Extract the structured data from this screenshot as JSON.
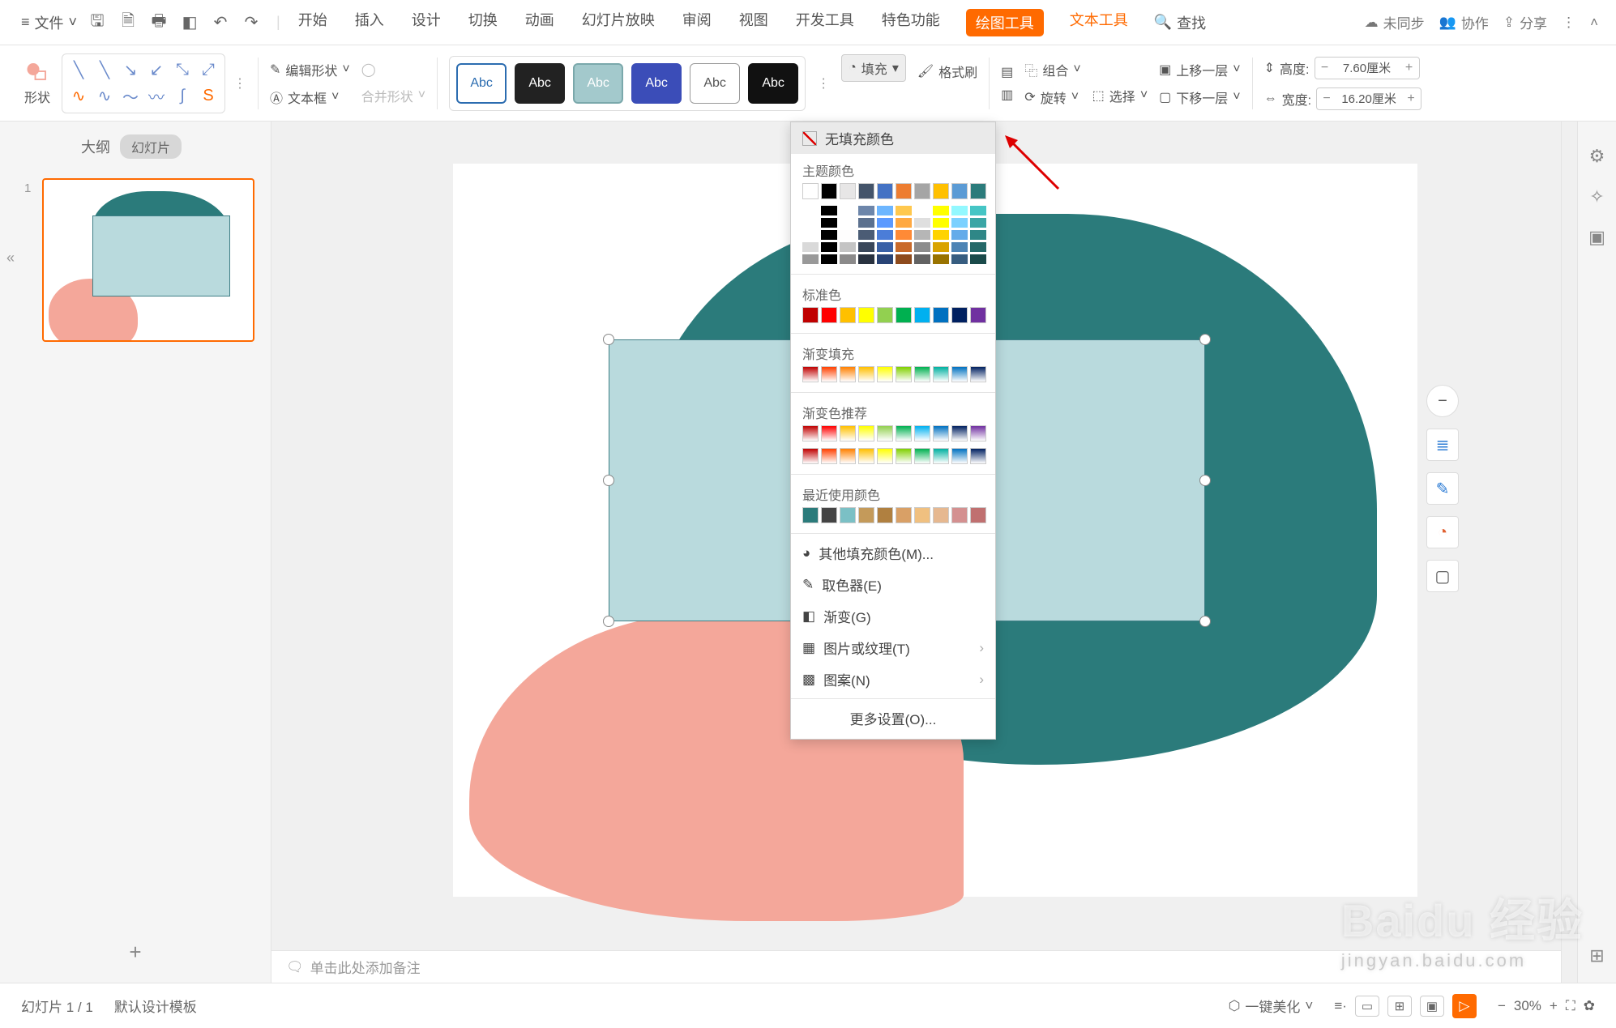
{
  "topbar": {
    "file_label": "文件",
    "tabs": [
      "开始",
      "插入",
      "设计",
      "切换",
      "动画",
      "幻灯片放映",
      "审阅",
      "视图",
      "开发工具",
      "特色功能"
    ],
    "drawing_tools": "绘图工具",
    "text_tools": "文本工具",
    "search": "查找",
    "unsynced": "未同步",
    "collab": "协作",
    "share": "分享"
  },
  "ribbon": {
    "shape_label": "形状",
    "edit_shape": "编辑形状",
    "textbox": "文本框",
    "merge_shape": "合并形状",
    "abc": "Abc",
    "fill_btn": "填充",
    "format_painter": "格式刷",
    "group": "组合",
    "rotate": "旋转",
    "select": "选择",
    "bring_forward": "上移一层",
    "send_backward": "下移一层",
    "height_label": "高度:",
    "width_label": "宽度:",
    "height_val": "7.60厘米",
    "width_val": "16.20厘米"
  },
  "side": {
    "outline": "大纲",
    "slides": "幻灯片",
    "slide_num": "1"
  },
  "fill_dropdown": {
    "no_fill": "无填充颜色",
    "theme": "主题颜色",
    "standard": "标准色",
    "gradient_fill": "渐变填充",
    "gradient_preset": "渐变色推荐",
    "recent": "最近使用颜色",
    "more_fill": "其他填充颜色(M)...",
    "eyedropper": "取色器(E)",
    "gradient": "渐变(G)",
    "picture_texture": "图片或纹理(T)",
    "pattern": "图案(N)",
    "more_settings": "更多设置(O)...",
    "theme_base": [
      "#ffffff",
      "#000000",
      "#e7e6e6",
      "#44546a",
      "#4472c4",
      "#ed7d31",
      "#a5a5a5",
      "#ffc000",
      "#5b9bd5",
      "#2b7b7b"
    ],
    "standard_colors": [
      "#c00000",
      "#ff0000",
      "#ffc000",
      "#ffff00",
      "#92d050",
      "#00b050",
      "#00b0f0",
      "#0070c0",
      "#002060",
      "#7030a0"
    ],
    "gradient_colors": [
      "#c00000",
      "#ff4000",
      "#ff8000",
      "#ffbf00",
      "#ffff00",
      "#80d000",
      "#00b050",
      "#00b0a0",
      "#0070c0",
      "#002060"
    ],
    "recent_colors": [
      "#2b7b7b",
      "#444444",
      "#7bc0c5",
      "#c49a5a",
      "#b08040",
      "#d9a066",
      "#f0c080",
      "#e6b890",
      "#d49090",
      "#c07070"
    ]
  },
  "notes": "单击此处添加备注",
  "status": {
    "slide_indicator": "幻灯片 1 / 1",
    "template": "默认设计模板",
    "beautify": "一键美化",
    "zoom": "30%"
  },
  "watermark": {
    "brand": "Baidu 经验",
    "url": "jingyan.baidu.com"
  }
}
